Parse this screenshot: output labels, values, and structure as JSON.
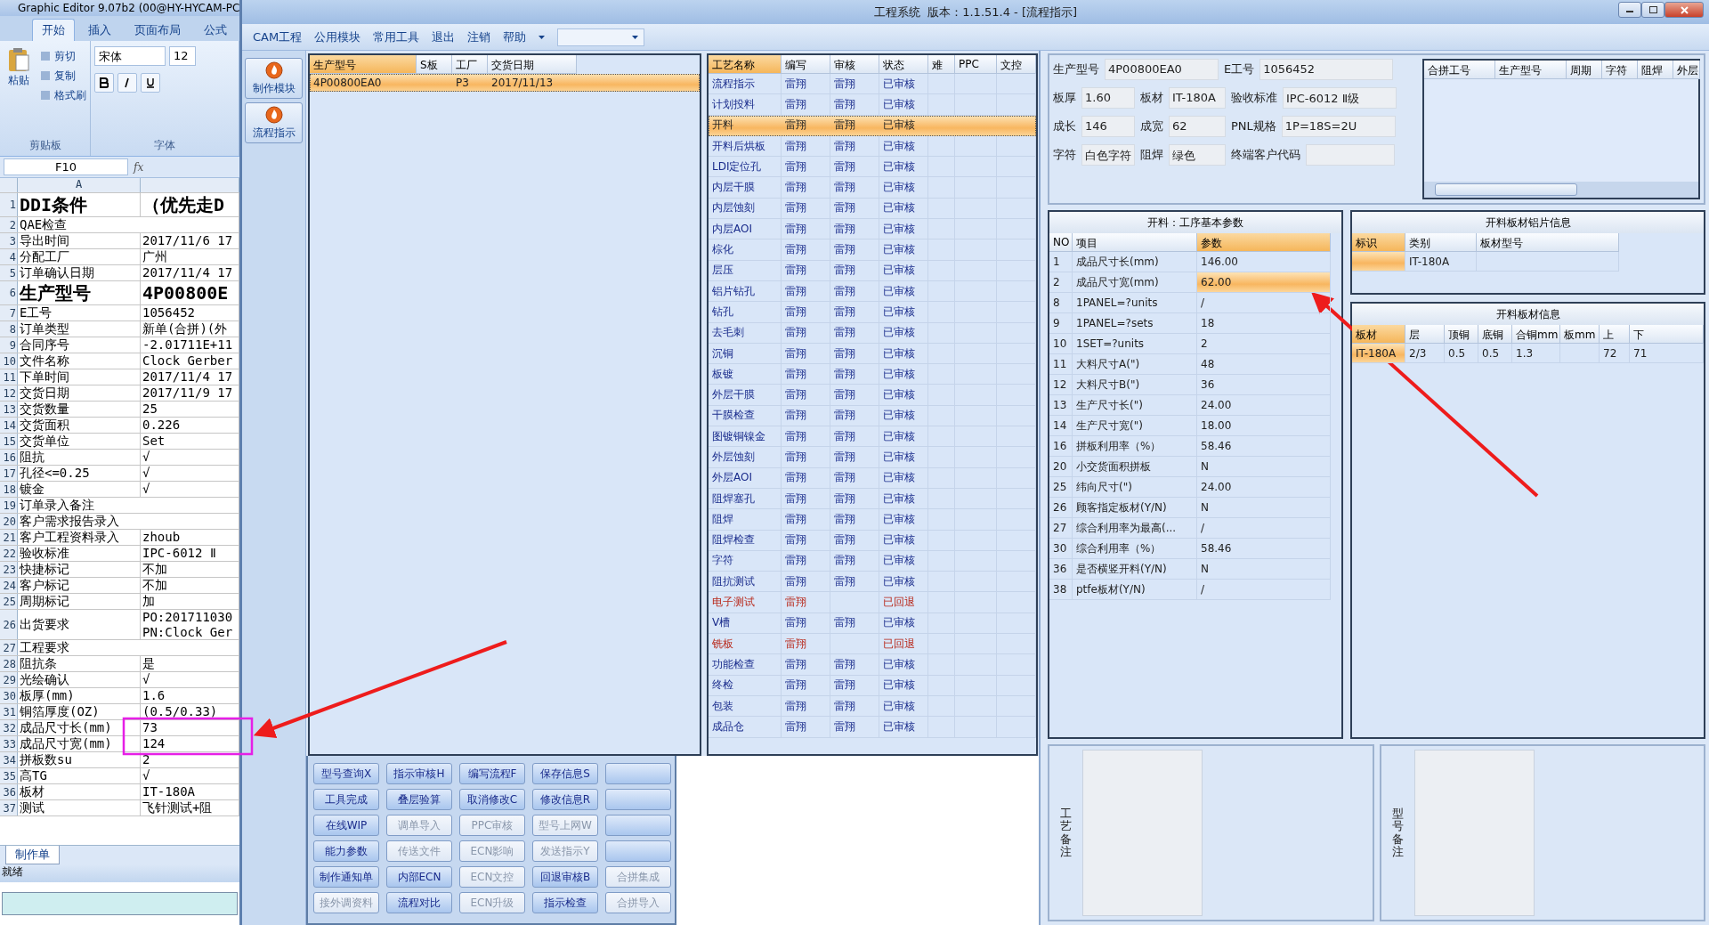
{
  "excel": {
    "title": "Graphic Editor 9.07b2 (00@HY-HYCAM-PC",
    "tabs": [
      {
        "label": "开始",
        "selected": true
      },
      {
        "label": "插入",
        "selected": false
      },
      {
        "label": "页面布局",
        "selected": false
      },
      {
        "label": "公式",
        "selected": false
      }
    ],
    "paste": "粘贴",
    "clipboard": [
      "剪切",
      "复制",
      "格式刷"
    ],
    "group_clipboard": "剪贴板",
    "group_font": "字体",
    "font_name": "宋体",
    "font_size": "12",
    "cell_ref": "F10",
    "fx": "fx",
    "column_a": "A",
    "rows": [
      {
        "num": "1",
        "a": "DDI条件",
        "b": "（优先走D",
        "kind": "big"
      },
      {
        "num": "2",
        "a": "QAE检查",
        "kind": "span"
      },
      {
        "num": "3",
        "a": "导出时间",
        "b": "2017/11/6 17",
        "kind": "normal"
      },
      {
        "num": "4",
        "a": "分配工厂",
        "b": "广州",
        "kind": "normal"
      },
      {
        "num": "5",
        "a": "订单确认日期",
        "b": "2017/11/4 17",
        "kind": "normal"
      },
      {
        "num": "6",
        "a": "生产型号",
        "b": "4P00800E",
        "kind": "big"
      },
      {
        "num": "7",
        "a": "E工号",
        "b": "1056452",
        "kind": "normal"
      },
      {
        "num": "8",
        "a": "订单类型",
        "b": "新单(合拼)(外",
        "kind": "normal"
      },
      {
        "num": "9",
        "a": "合同序号",
        "b": "-2.01711E+11",
        "kind": "normal"
      },
      {
        "num": "10",
        "a": "文件名称",
        "b": "Clock Gerber",
        "kind": "normal"
      },
      {
        "num": "11",
        "a": "下单时间",
        "b": "2017/11/4 17",
        "kind": "normal"
      },
      {
        "num": "12",
        "a": "交货日期",
        "b": "2017/11/9 17",
        "kind": "normal"
      },
      {
        "num": "13",
        "a": "交货数量",
        "b": "25",
        "kind": "normal"
      },
      {
        "num": "14",
        "a": "交货面积",
        "b": "0.226",
        "kind": "normal"
      },
      {
        "num": "15",
        "a": "交货单位",
        "b": "Set",
        "kind": "normal"
      },
      {
        "num": "16",
        "a": "阻抗",
        "b": "√",
        "kind": "normal"
      },
      {
        "num": "17",
        "a": "孔径<=0.25",
        "b": "√",
        "kind": "normal"
      },
      {
        "num": "18",
        "a": "镀金",
        "b": "√",
        "kind": "normal"
      },
      {
        "num": "19",
        "a": "订单录入备注",
        "kind": "span"
      },
      {
        "num": "20",
        "a": "客户需求报告录入",
        "kind": "span"
      },
      {
        "num": "21",
        "a": "客户工程资料录入",
        "b": "zhoub",
        "kind": "normal"
      },
      {
        "num": "22",
        "a": "验收标准",
        "b": "IPC-6012 Ⅱ",
        "kind": "normal"
      },
      {
        "num": "23",
        "a": "快捷标记",
        "b": "不加",
        "kind": "normal"
      },
      {
        "num": "24",
        "a": "客户标记",
        "b": "不加",
        "kind": "normal"
      },
      {
        "num": "25",
        "a": "周期标记",
        "b": "加",
        "kind": "normal"
      },
      {
        "num": "26",
        "a": "出货要求",
        "b": "PO:201711030",
        "b2": "PN:Clock Ger",
        "kind": "tall"
      },
      {
        "num": "27",
        "a": "工程要求",
        "kind": "span"
      },
      {
        "num": "28",
        "a": "阻抗条",
        "b": "是",
        "kind": "normal"
      },
      {
        "num": "29",
        "a": "光绘确认",
        "b": "√",
        "kind": "normal"
      },
      {
        "num": "30",
        "a": "板厚(mm)",
        "b": "1.6",
        "kind": "normal"
      },
      {
        "num": "31",
        "a": "铜箔厚度(OZ)",
        "b": "(0.5/0.33)",
        "kind": "normal"
      },
      {
        "num": "32",
        "a": "成品尺寸长(mm)",
        "b": "73",
        "kind": "normal"
      },
      {
        "num": "33",
        "a": "成品尺寸宽(mm)",
        "b": "124",
        "kind": "normal"
      },
      {
        "num": "34",
        "a": "拼板数su",
        "b": "2",
        "kind": "normal"
      },
      {
        "num": "35",
        "a": "高TG",
        "b": "√",
        "kind": "normal"
      },
      {
        "num": "36",
        "a": "板材",
        "b": "IT-180A",
        "kind": "normal"
      },
      {
        "num": "37",
        "a": "测试",
        "b": "飞针测试+阻",
        "kind": "normal"
      }
    ],
    "sheet_tab": "制作单",
    "status": "就绪"
  },
  "app": {
    "title": "工程系统  版本：1.1.51.4 - [流程指示]",
    "menu": [
      "CAM工程",
      "公用模块",
      "常用工具",
      "退出",
      "注销",
      "帮助"
    ],
    "side_buttons": [
      "制作模块",
      "流程指示"
    ],
    "orders": {
      "columns": [
        "生产型号",
        "S板",
        "工厂",
        "交货日期"
      ],
      "rows": [
        {
          "cells": [
            "4P00800EA0",
            "",
            "P3",
            "2017/11/13"
          ],
          "selected": true
        }
      ]
    },
    "process": {
      "columns": [
        "工艺名称",
        "编写",
        "审核",
        "状态",
        "难",
        "PPC",
        "文控"
      ],
      "rows": [
        {
          "name": "流程指示",
          "writer": "雷翔",
          "reviewer": "雷翔",
          "status": "已审核",
          "returned": false,
          "selected": false
        },
        {
          "name": "计划投料",
          "writer": "雷翔",
          "reviewer": "雷翔",
          "status": "已审核",
          "returned": false,
          "selected": false
        },
        {
          "name": "开料",
          "writer": "雷翔",
          "reviewer": "雷翔",
          "status": "已审核",
          "returned": false,
          "selected": true
        },
        {
          "name": "开料后烘板",
          "writer": "雷翔",
          "reviewer": "雷翔",
          "status": "已审核",
          "returned": false,
          "selected": false
        },
        {
          "name": "LDI定位孔",
          "writer": "雷翔",
          "reviewer": "雷翔",
          "status": "已审核",
          "returned": false,
          "selected": false
        },
        {
          "name": "内层干膜",
          "writer": "雷翔",
          "reviewer": "雷翔",
          "status": "已审核",
          "returned": false,
          "selected": false
        },
        {
          "name": "内层蚀刻",
          "writer": "雷翔",
          "reviewer": "雷翔",
          "status": "已审核",
          "returned": false,
          "selected": false
        },
        {
          "name": "内层AOI",
          "writer": "雷翔",
          "reviewer": "雷翔",
          "status": "已审核",
          "returned": false,
          "selected": false
        },
        {
          "name": "棕化",
          "writer": "雷翔",
          "reviewer": "雷翔",
          "status": "已审核",
          "returned": false,
          "selected": false
        },
        {
          "name": "层压",
          "writer": "雷翔",
          "reviewer": "雷翔",
          "status": "已审核",
          "returned": false,
          "selected": false
        },
        {
          "name": "铝片钻孔",
          "writer": "雷翔",
          "reviewer": "雷翔",
          "status": "已审核",
          "returned": false,
          "selected": false
        },
        {
          "name": "钻孔",
          "writer": "雷翔",
          "reviewer": "雷翔",
          "status": "已审核",
          "returned": false,
          "selected": false
        },
        {
          "name": "去毛刺",
          "writer": "雷翔",
          "reviewer": "雷翔",
          "status": "已审核",
          "returned": false,
          "selected": false
        },
        {
          "name": "沉铜",
          "writer": "雷翔",
          "reviewer": "雷翔",
          "status": "已审核",
          "returned": false,
          "selected": false
        },
        {
          "name": "板镀",
          "writer": "雷翔",
          "reviewer": "雷翔",
          "status": "已审核",
          "returned": false,
          "selected": false
        },
        {
          "name": "外层干膜",
          "writer": "雷翔",
          "reviewer": "雷翔",
          "status": "已审核",
          "returned": false,
          "selected": false
        },
        {
          "name": "干膜检查",
          "writer": "雷翔",
          "reviewer": "雷翔",
          "status": "已审核",
          "returned": false,
          "selected": false
        },
        {
          "name": "图镀铜镍金",
          "writer": "雷翔",
          "reviewer": "雷翔",
          "status": "已审核",
          "returned": false,
          "selected": false
        },
        {
          "name": "外层蚀刻",
          "writer": "雷翔",
          "reviewer": "雷翔",
          "status": "已审核",
          "returned": false,
          "selected": false
        },
        {
          "name": "外层AOI",
          "writer": "雷翔",
          "reviewer": "雷翔",
          "status": "已审核",
          "returned": false,
          "selected": false
        },
        {
          "name": "阻焊塞孔",
          "writer": "雷翔",
          "reviewer": "雷翔",
          "status": "已审核",
          "returned": false,
          "selected": false
        },
        {
          "name": "阻焊",
          "writer": "雷翔",
          "reviewer": "雷翔",
          "status": "已审核",
          "returned": false,
          "selected": false
        },
        {
          "name": "阻焊检查",
          "writer": "雷翔",
          "reviewer": "雷翔",
          "status": "已审核",
          "returned": false,
          "selected": false
        },
        {
          "name": "字符",
          "writer": "雷翔",
          "reviewer": "雷翔",
          "status": "已审核",
          "returned": false,
          "selected": false
        },
        {
          "name": "阻抗测试",
          "writer": "雷翔",
          "reviewer": "雷翔",
          "status": "已审核",
          "returned": false,
          "selected": false
        },
        {
          "name": "电子测试",
          "writer": "雷翔",
          "status": "已回退",
          "returned": true,
          "selected": false
        },
        {
          "name": "V槽",
          "writer": "雷翔",
          "reviewer": "雷翔",
          "status": "已审核",
          "returned": false,
          "selected": false
        },
        {
          "name": "铣板",
          "writer": "雷翔",
          "status": "已回退",
          "returned": true,
          "selected": false
        },
        {
          "name": "功能检查",
          "writer": "雷翔",
          "reviewer": "雷翔",
          "status": "已审核",
          "returned": false,
          "selected": false
        },
        {
          "name": "终检",
          "writer": "雷翔",
          "reviewer": "雷翔",
          "status": "已审核",
          "returned": false,
          "selected": false
        },
        {
          "name": "包装",
          "writer": "雷翔",
          "reviewer": "雷翔",
          "status": "已审核",
          "returned": false,
          "selected": false
        },
        {
          "name": "成品仓",
          "writer": "雷翔",
          "reviewer": "雷翔",
          "status": "已审核",
          "returned": false,
          "selected": false
        }
      ]
    },
    "buttons": [
      {
        "kind": "label",
        "label": "型号查询X",
        "disabled": false
      },
      {
        "kind": "label",
        "label": "指示审核H",
        "disabled": false
      },
      {
        "kind": "label",
        "label": "编写流程F",
        "disabled": false
      },
      {
        "kind": "label",
        "label": "保存信息S",
        "disabled": false
      },
      {
        "kind": "blank"
      },
      {
        "kind": "label",
        "label": "工具完成",
        "disabled": false
      },
      {
        "kind": "label",
        "label": "叠层验算",
        "disabled": false
      },
      {
        "kind": "label",
        "label": "取消修改C",
        "disabled": false
      },
      {
        "kind": "label",
        "label": "修改信息R",
        "disabled": false
      },
      {
        "kind": "blank"
      },
      {
        "kind": "label",
        "label": "在线WIP",
        "disabled": false
      },
      {
        "kind": "label",
        "label": "调单导入",
        "disabled": true
      },
      {
        "kind": "label",
        "label": "PPC审核",
        "disabled": true
      },
      {
        "kind": "label",
        "label": "型号上网W",
        "disabled": true
      },
      {
        "kind": "blank"
      },
      {
        "kind": "label",
        "label": "能力参数",
        "disabled": false
      },
      {
        "kind": "label",
        "label": "传送文件",
        "disabled": true
      },
      {
        "kind": "label",
        "label": "ECN影响",
        "disabled": true
      },
      {
        "kind": "label",
        "label": "发送指示Y",
        "disabled": true
      },
      {
        "kind": "blank"
      },
      {
        "kind": "label",
        "label": "制作通知单",
        "disabled": false
      },
      {
        "kind": "label",
        "label": "内部ECN",
        "disabled": false
      },
      {
        "kind": "label",
        "label": "ECN文控",
        "disabled": true
      },
      {
        "kind": "label",
        "label": "回退审核B",
        "disabled": false
      },
      {
        "kind": "label",
        "label": "合拼集成",
        "disabled": true
      },
      {
        "kind": "label",
        "label": "接外调资料",
        "disabled": true
      },
      {
        "kind": "label",
        "label": "流程对比",
        "disabled": false
      },
      {
        "kind": "label",
        "label": "ECN升级",
        "disabled": true
      },
      {
        "kind": "label",
        "label": "指示检查",
        "disabled": false
      },
      {
        "kind": "label",
        "label": "合拼导入",
        "disabled": true
      }
    ],
    "info": [
      [
        {
          "label": "生产型号",
          "value": "4P00800EA0"
        },
        {
          "label": "E工号",
          "value": "1056452"
        }
      ],
      [
        {
          "label": "板厚",
          "value": "1.60"
        },
        {
          "label": "板材",
          "value": "IT-180A"
        },
        {
          "label": "验收标准",
          "value": "IPC-6012 Ⅱ级"
        }
      ],
      [
        {
          "label": "成长",
          "value": "146"
        },
        {
          "label": "成宽",
          "value": "62"
        },
        {
          "label": "PNL规格",
          "value": "1P=18S=2U"
        }
      ],
      [
        {
          "label": "字符",
          "value": "白色字符"
        },
        {
          "label": "阻焊",
          "value": "绿色"
        },
        {
          "label": "终端客户代码"
        }
      ]
    ],
    "merge_table": {
      "columns": [
        "合拼工号",
        "生产型号",
        "周期",
        "字符",
        "阻焊",
        "外层"
      ]
    },
    "params": {
      "title": "开料：工序基本参数",
      "columns": [
        "NO",
        "项目",
        "参数"
      ],
      "rows": [
        {
          "no": "1",
          "item": "成品尺寸长(mm)",
          "value": "146.00",
          "selected": false
        },
        {
          "no": "2",
          "item": "成品尺寸宽(mm)",
          "value": "62.00",
          "selected": true
        },
        {
          "no": "8",
          "item": "1PANEL=?units",
          "value": "/",
          "selected": false
        },
        {
          "no": "9",
          "item": "1PANEL=?sets",
          "value": "18",
          "selected": false
        },
        {
          "no": "10",
          "item": "1SET=?units",
          "value": "2",
          "selected": false
        },
        {
          "no": "11",
          "item": "大料尺寸A(\")",
          "value": "48",
          "selected": false
        },
        {
          "no": "12",
          "item": "大料尺寸B(\")",
          "value": "36",
          "selected": false
        },
        {
          "no": "13",
          "item": "生产尺寸长(\")",
          "value": "24.00",
          "selected": false
        },
        {
          "no": "14",
          "item": "生产尺寸宽(\")",
          "value": "18.00",
          "selected": false
        },
        {
          "no": "16",
          "item": "拼板利用率（%）",
          "value": "58.46",
          "selected": false
        },
        {
          "no": "20",
          "item": "小交货面积拼板",
          "value": "N",
          "selected": false
        },
        {
          "no": "25",
          "item": "纬向尺寸(\")",
          "value": "24.00",
          "selected": false
        },
        {
          "no": "26",
          "item": "顾客指定板材(Y/N)",
          "value": "N",
          "selected": false
        },
        {
          "no": "27",
          "item": "综合利用率为最高(...",
          "value": "/",
          "selected": false
        },
        {
          "no": "30",
          "item": "综合利用率（%）",
          "value": "58.46",
          "selected": false
        },
        {
          "no": "36",
          "item": "是否横竖开料(Y/N)",
          "value": "N",
          "selected": false
        },
        {
          "no": "38",
          "item": "ptfe板材(Y/N)",
          "value": "/",
          "selected": false
        }
      ]
    },
    "foil": {
      "title": "开料板材铝片信息",
      "columns": [
        "标识",
        "类别",
        "板材型号"
      ],
      "rows": [
        [
          "",
          "IT-180A",
          ""
        ]
      ]
    },
    "board": {
      "title": "开料板材信息",
      "columns": [
        "板材",
        "层",
        "顶铜",
        "底铜",
        "合铜mm",
        "板mm",
        "上",
        "下"
      ],
      "rows": [
        [
          "IT-180A",
          "2/3",
          "0.5",
          "0.5",
          "1.3",
          "",
          "72",
          "71"
        ]
      ]
    },
    "remarks": [
      "工艺备注",
      "型号备注"
    ]
  }
}
